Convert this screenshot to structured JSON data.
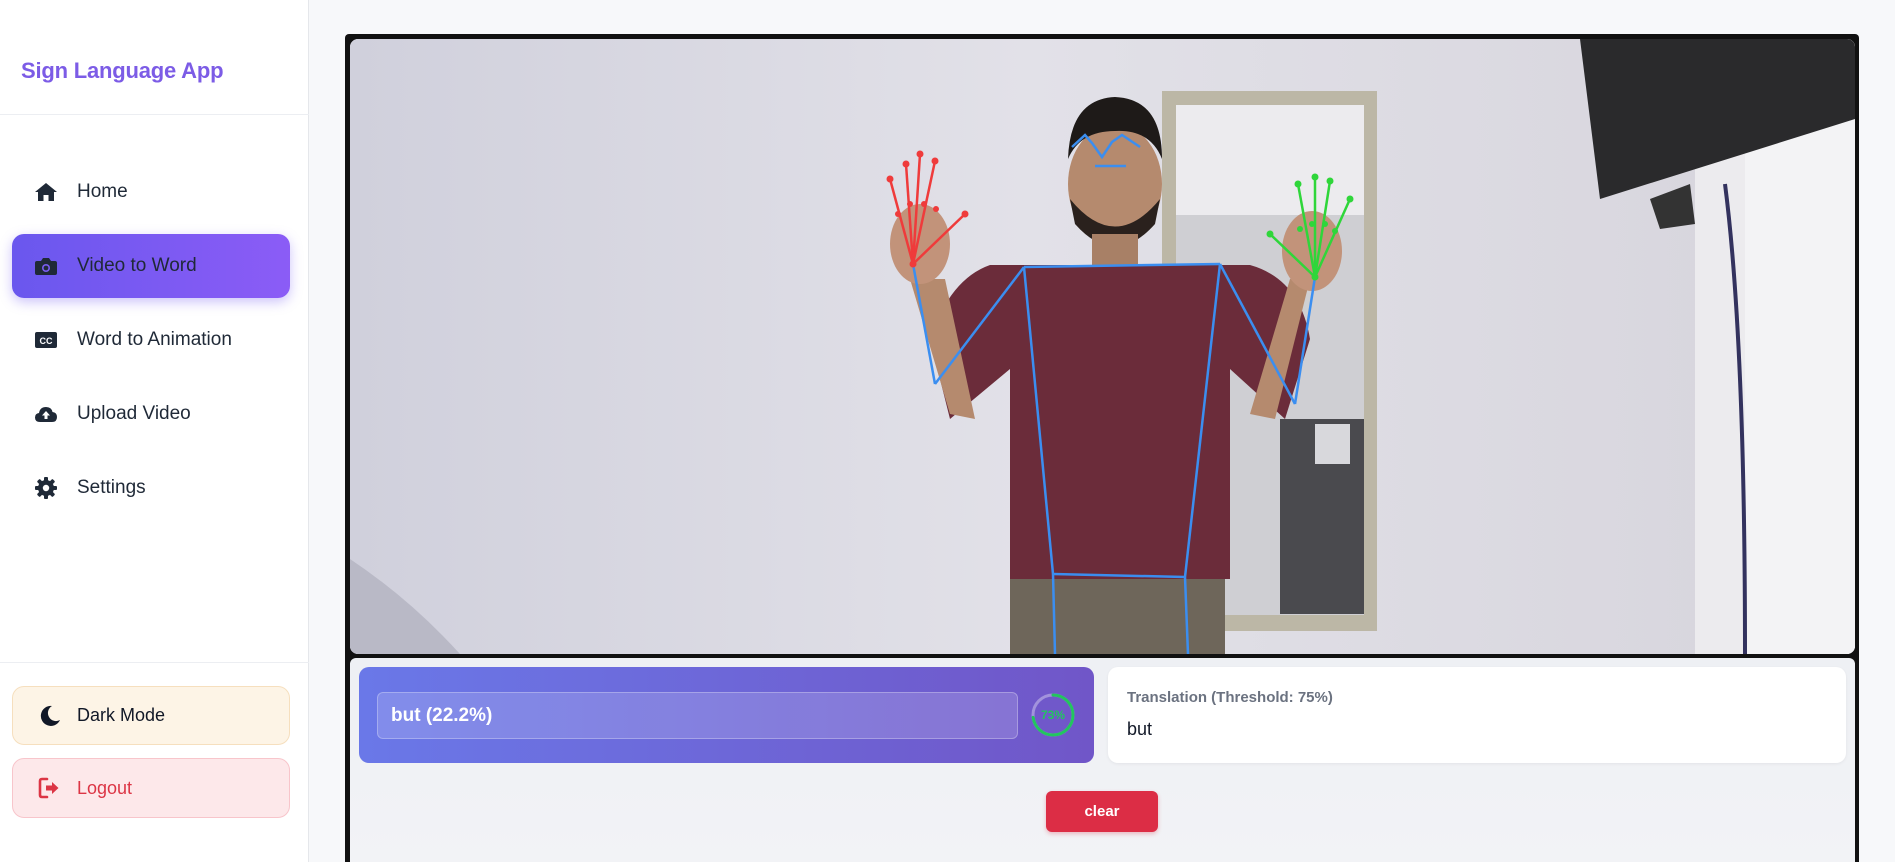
{
  "app": {
    "title": "Sign Language App"
  },
  "nav": {
    "items": [
      {
        "label": "Home",
        "icon": "home-icon"
      },
      {
        "label": "Video to Word",
        "icon": "camera-icon",
        "active": true
      },
      {
        "label": "Word to Animation",
        "icon": "closed-captions-icon"
      },
      {
        "label": "Upload Video",
        "icon": "cloud-upload-icon"
      },
      {
        "label": "Settings",
        "icon": "gear-icon"
      }
    ]
  },
  "footer": {
    "dark_mode_label": "Dark Mode",
    "logout_label": "Logout"
  },
  "prediction": {
    "text": "but (22.2%)",
    "gauge_percent": 73,
    "gauge_label": "73%"
  },
  "translation": {
    "label": "Translation (Threshold: 75%)",
    "value": "but"
  },
  "actions": {
    "clear_label": "clear"
  },
  "colors": {
    "accent": "#7c5ce6",
    "active_nav": "#6a57ee",
    "clear": "#dc2d45",
    "gauge": "#22c55e",
    "pose_blue": "#3b8ef0",
    "left_hand": "#ef3b3b",
    "right_hand": "#2fd63a"
  }
}
